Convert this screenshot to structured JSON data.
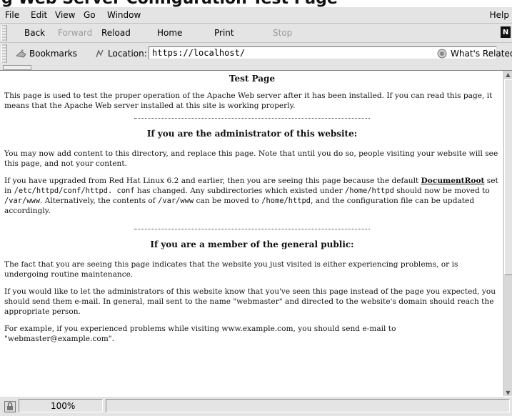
{
  "menu": [
    "File",
    "Edit",
    "View",
    "Go",
    "Window"
  ],
  "menu_help": "Help",
  "toolbar": {
    "back": "Back",
    "forward": "Forward",
    "reload": "Reload",
    "home": "Home",
    "print": "Print",
    "stop": "Stop"
  },
  "location_bar": {
    "bookmarks": "Bookmarks",
    "location_label": "Location:",
    "url": "https://localhost/",
    "whats_related": "What's Related"
  },
  "page": {
    "title": "Test Page",
    "intro": "This page is used to test the proper operation of the Apache Web server after it has been installed. If you can read this page, it means that the Apache Web server installed at this site is working properly.",
    "admin_heading": "If you are the administrator of this website:",
    "admin_p1": "You may now add content to this directory, and replace this page. Note that until you do so, people visiting your website will see this page, and not your content.",
    "admin_p2": {
      "t1": "If you have upgraded from Red Hat Linux 6.2 and earlier, then you are seeing this page because the default ",
      "link": "DocumentRoot",
      "t2": " set in ",
      "c1": "/etc/httpd/conf/httpd. conf",
      "t3": " has changed. Any subdirectories which existed under ",
      "c2": "/home/httpd",
      "t4": " should now be moved to ",
      "c3": "/var/www",
      "t5": ". Alternatively, the contents of ",
      "c4": "/var/www",
      "t6": " can be moved to ",
      "c5": "/home/httpd",
      "t7": ", and the configuration file can be updated accordingly."
    },
    "public_heading": "If you are a member of the general public:",
    "public_p1": "The fact that you are seeing this page indicates that the website you just visited is either experiencing problems, or is undergoing routine maintenance.",
    "public_p2": "If you would like to let the administrators of this website know that you've seen this page instead of the page you expected, you should send them e-mail. In general, mail sent to the name \"webmaster\" and directed to the website's domain should reach the appropriate person.",
    "public_p3": "For example, if you experienced problems while visiting www.example.com, you should send e-mail to \"webmaster@example.com\"."
  },
  "status": {
    "zoom": "100%"
  }
}
